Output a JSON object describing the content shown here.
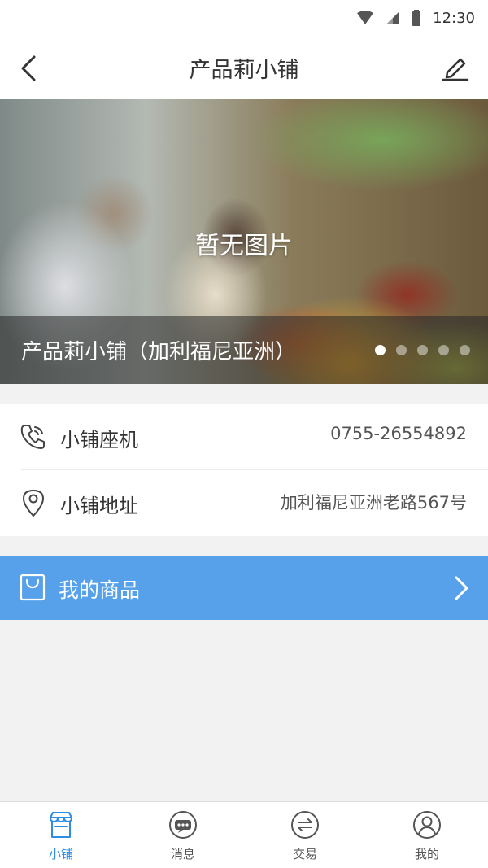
{
  "status_bar": {
    "time": "12:30"
  },
  "header": {
    "title": "产品莉小铺"
  },
  "banner": {
    "placeholder": "暂无图片",
    "caption": "产品莉小铺（加利福尼亚洲）",
    "dot_count": 5,
    "active_index": 0
  },
  "info": {
    "phone": {
      "label": "小铺座机",
      "value": "0755-26554892"
    },
    "address": {
      "label": "小铺地址",
      "value": "加利福尼亚洲老路567号"
    }
  },
  "my_goods": {
    "label": "我的商品"
  },
  "tabs": [
    {
      "label": "小铺",
      "icon": "shop-icon",
      "active": true
    },
    {
      "label": "消息",
      "icon": "message-icon",
      "active": false
    },
    {
      "label": "交易",
      "icon": "exchange-icon",
      "active": false
    },
    {
      "label": "我的",
      "icon": "user-icon",
      "active": false
    }
  ],
  "colors": {
    "accent": "#56a1ea",
    "tab_active": "#2f8de4"
  }
}
